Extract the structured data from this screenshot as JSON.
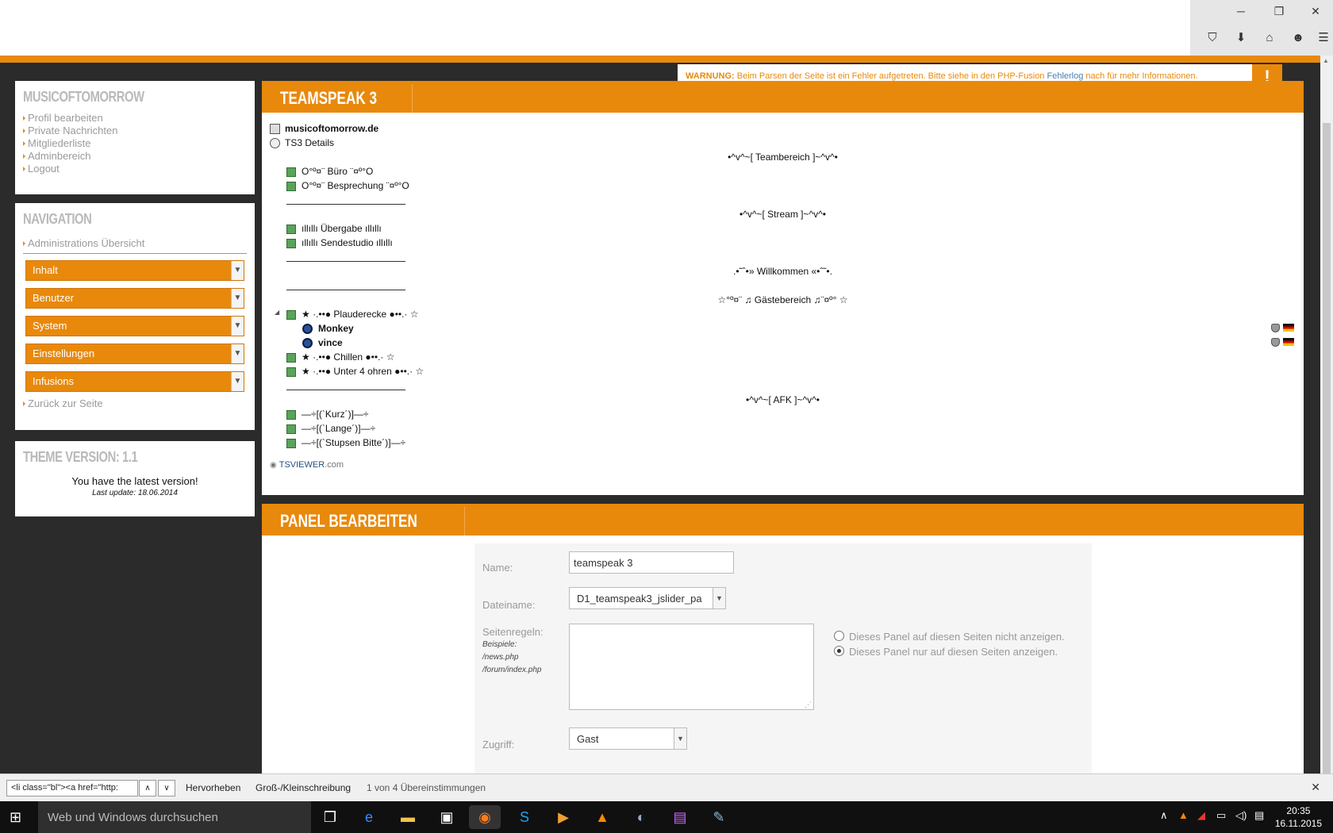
{
  "warning": {
    "prefix": "WARNUNG:",
    "text": "Beim Parsen der Seite ist ein Fehler aufgetreten. Bitte siehe in den PHP-Fusion",
    "link": "Fehlerlog",
    "suffix": "nach für mehr Informationen.",
    "bang": "!"
  },
  "user_panel": {
    "title": "MUSICOFTOMORROW",
    "links": [
      "Profil bearbeiten",
      "Private Nachrichten",
      "Mitgliederliste",
      "Adminbereich",
      "Logout"
    ]
  },
  "nav_panel": {
    "title": "NAVIGATION",
    "overview": "Administrations Übersicht",
    "dropdowns": [
      "Inhalt",
      "Benutzer",
      "System",
      "Einstellungen",
      "Infusions"
    ],
    "back": "Zurück zur Seite"
  },
  "theme_panel": {
    "title": "THEME VERSION: 1.1",
    "message": "You have the latest version!",
    "updated": "Last update: 18.06.2014"
  },
  "ts_panel": {
    "title": "TEAMSPEAK 3",
    "server": "musicoftomorrow.de",
    "details": "TS3 Details",
    "spacers": [
      "•^v^~[ Teambereich ]~^v^•",
      "•^v^~[ Stream ]~^v^•",
      ".•˜ˆ•» Willkommen «•ˆ˜•.",
      "☆°º¤¨ ♫ Gästebereich ♫¨¤º° ☆",
      "•^v^~[ AFK ]~^v^•"
    ],
    "channels_team": [
      "O°º¤¨ Büro ¨¤º°O",
      "O°º¤¨ Besprechung ¨¤º°O"
    ],
    "channels_stream": [
      "ıllıllı Übergabe ıllıllı",
      "ıllıllı Sendestudio ıllıllı"
    ],
    "channel_plauder": "★ ·.••● Plauderecke ●••.· ☆",
    "users": [
      "Monkey",
      "vince"
    ],
    "channels_guest_rest": [
      "★ ·.••● Chillen ●••.· ☆",
      "★ ·.••● Unter 4 ohren ●••.· ☆"
    ],
    "channels_afk": [
      "—÷[(`Kurz´)]—÷",
      "—÷[(`Lange´)]—÷",
      "—÷[(`Stupsen Bitte´)]—÷"
    ],
    "footer": "TSVIEWER",
    "footer_suffix": ".com"
  },
  "edit_panel": {
    "title": "PANEL BEARBEITEN",
    "name_label": "Name:",
    "name_value": "teamspeak 3",
    "file_label": "Dateiname:",
    "file_value": "D1_teamspeak3_jslider_pa",
    "rules_label": "Seitenregeln:",
    "examples_label": "Beispiele:",
    "examples": [
      "/news.php",
      "/forum/index.php"
    ],
    "radio_not_show": "Dieses Panel auf diesen Seiten nicht anzeigen.",
    "radio_only_show": "Dieses Panel nur auf diesen Seiten anzeigen.",
    "access_label": "Zugriff:",
    "access_value": "Gast"
  },
  "findbar": {
    "query": "<li class=\"bl\"><a href=\"http:",
    "highlight": "Hervorheben",
    "case": "Groß-/Kleinschreibung",
    "matches": "1 von 4 Übereinstimmungen"
  },
  "taskbar": {
    "search": "Web und Windows durchsuchen",
    "time": "20:35",
    "date": "16.11.2015"
  },
  "colors": {
    "accent": "#e8890c",
    "background": "#2b2b2b"
  }
}
